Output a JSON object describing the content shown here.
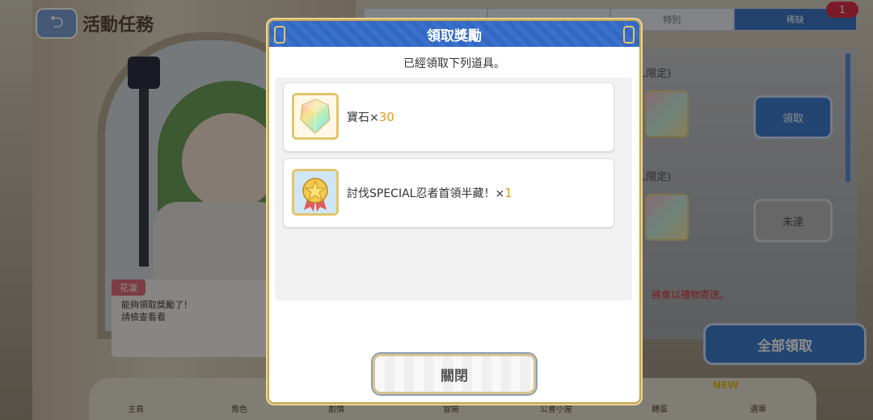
{
  "background": {
    "title": "活動任務",
    "tabs": [
      "",
      "",
      "特別",
      "稀缺"
    ],
    "badge": "1",
    "limit_labels": [
      "L限定)",
      "L限定)"
    ],
    "buttons": [
      "領取",
      "未達"
    ],
    "note": "將會以禮物寄送。",
    "claim_all": "全部領取",
    "dialog_name": "花凜",
    "dialog_lines": [
      "能夠領取獎勵了！",
      "請檢查看看"
    ],
    "nav": [
      "主頁",
      "角色",
      "劇情",
      "冒險",
      "公會小屋",
      "轉蛋",
      "選單"
    ],
    "new_label": "NEW"
  },
  "modal": {
    "title": "領取獎勵",
    "subtitle": "已經領取下列道具。",
    "rewards": [
      {
        "name": "寶石",
        "mult": "×",
        "count": "30",
        "icon": "rainbow-gem-icon"
      },
      {
        "name": "討伐SPECIAL忍者首領半藏！",
        "mult": "×",
        "count": "1",
        "icon": "gold-star-medal-icon"
      }
    ],
    "close_label": "關閉"
  },
  "colors": {
    "header_blue": "#3267c2",
    "gold_border": "#c6a24c",
    "count_orange": "#e79a1d"
  }
}
